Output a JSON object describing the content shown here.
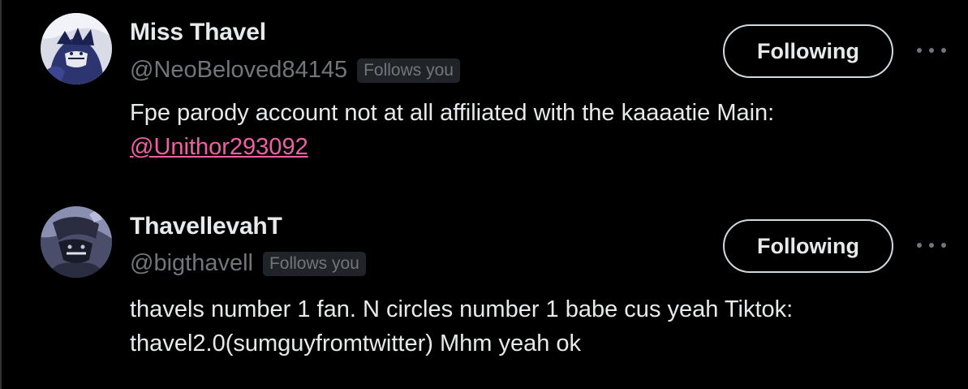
{
  "users": [
    {
      "display_name": "Miss Thavel",
      "handle": "@NeoBeloved84145",
      "follows_you": "Follows you",
      "bio_text": "Fpe parody account not at all affiliated with the kaaaatie Main:",
      "bio_link": "@Unithor293092",
      "follow_label": "Following",
      "avatar_icon": "avatar-drawn-character"
    },
    {
      "display_name": "ThavellevahT",
      "handle": "@bigthavell",
      "follows_you": "Follows you",
      "bio_line1": "thavels number 1 fan. N circles number 1 babe cus yeah Tiktok:",
      "bio_line2": "thavel2.0(sumguyfromtwitter) Mhm yeah ok",
      "follow_label": "Following",
      "avatar_icon": "avatar-dark-character"
    }
  ],
  "colors": {
    "background": "#000000",
    "text_primary": "#e7e9ea",
    "text_secondary": "#71767b",
    "link_pink": "#f05fa6",
    "badge_bg": "#202327",
    "border": "#cfd9de"
  }
}
